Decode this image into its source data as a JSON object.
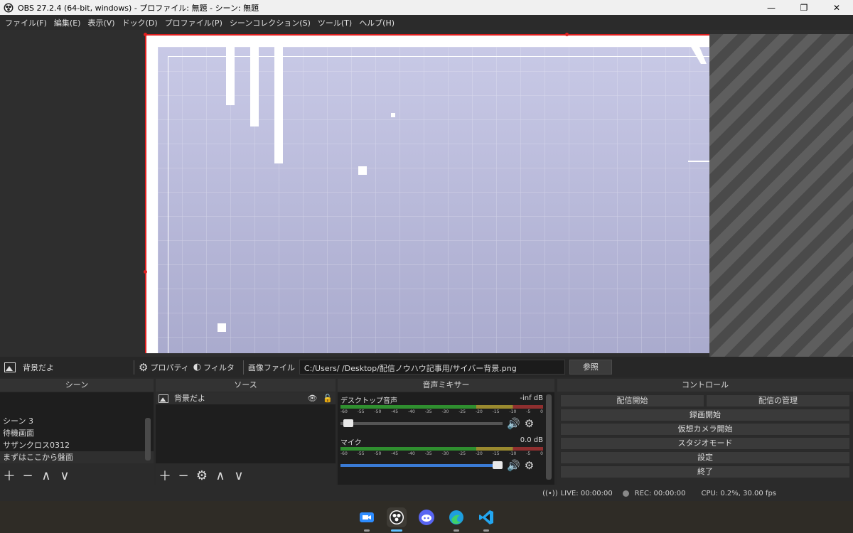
{
  "window": {
    "title": "OBS 27.2.4 (64-bit, windows) - プロファイル: 無題 - シーン: 無題",
    "minimize": "—",
    "restore": "❐",
    "close": "✕"
  },
  "menu": [
    "ファイル(F)",
    "編集(E)",
    "表示(V)",
    "ドック(D)",
    "プロファイル(P)",
    "シーンコレクション(S)",
    "ツール(T)",
    "ヘルプ(H)"
  ],
  "source_toolbar": {
    "selected_source": "背景だよ",
    "properties_label": "プロパティ",
    "filters_label": "フィルタ",
    "image_file_label": "画像ファイル",
    "image_path": "C:/Users/         /Desktop/配信ノウハウ記事用/サイバー背景.png",
    "browse_label": "参照"
  },
  "docks": {
    "scenes": {
      "title": "シーン",
      "items": [
        "シーン 3",
        "待機画面",
        "サザンクロス0312",
        "まずはここから盤面"
      ],
      "controls": [
        "＋",
        "−",
        "∧",
        "∨"
      ]
    },
    "sources": {
      "title": "ソース",
      "items": [
        "背景だよ"
      ],
      "controls": [
        "＋",
        "−",
        "⚙",
        "∧",
        "∨"
      ]
    },
    "mixer": {
      "title": "音声ミキサー",
      "channels": [
        {
          "name": "デスクトップ音声",
          "level": "-inf dB",
          "fader": 0.02
        },
        {
          "name": "マイク",
          "level": "0.0 dB",
          "fader": 1.0
        }
      ],
      "ticks": [
        "-60",
        "-55",
        "-50",
        "-45",
        "-40",
        "-35",
        "-30",
        "-25",
        "-20",
        "-15",
        "-10",
        "-5",
        "0"
      ]
    },
    "controls": {
      "title": "コントロール",
      "start_stream": "配信開始",
      "manage_stream": "配信の管理",
      "start_recording": "録画開始",
      "start_virtual_cam": "仮想カメラ開始",
      "studio_mode": "スタジオモード",
      "settings": "設定",
      "exit": "終了"
    }
  },
  "status": {
    "live": "LIVE: 00:00:00",
    "rec": "REC: 00:00:00",
    "cpu": "CPU: 0.2%, 30.00 fps"
  },
  "taskbar_icons": [
    "zoom-icon",
    "obs-icon",
    "discord-icon",
    "edge-icon",
    "vscode-icon"
  ],
  "colors": {
    "selection_border": "#e02020",
    "accent_blue": "#3a7bd5"
  }
}
